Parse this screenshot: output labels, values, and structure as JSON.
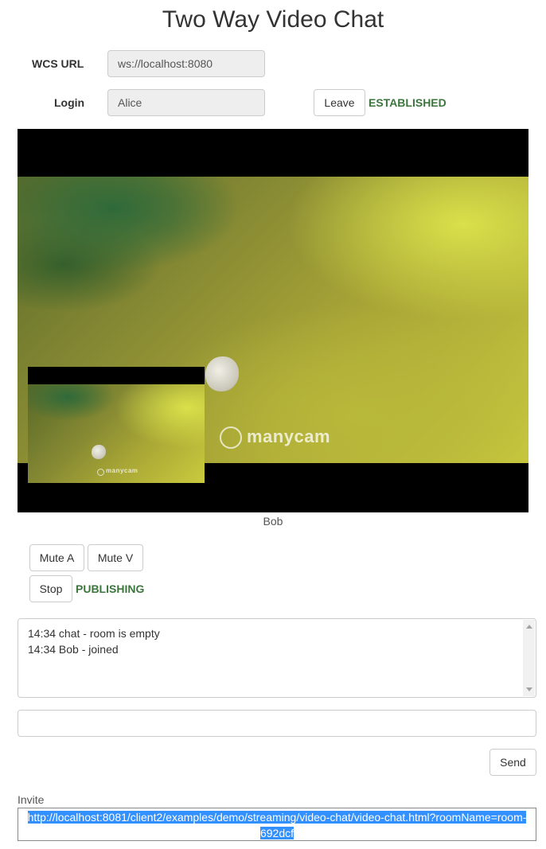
{
  "page": {
    "title": "Two Way Video Chat"
  },
  "connection": {
    "wcs_url_label": "WCS URL",
    "wcs_url_value": "ws://localhost:8080",
    "login_label": "Login",
    "login_value": "Alice",
    "leave_label": "Leave",
    "status": "ESTABLISHED"
  },
  "video": {
    "remote_participant": "Bob",
    "watermark": "manycam"
  },
  "controls": {
    "mute_audio_label": "Mute A",
    "mute_video_label": "Mute V",
    "stop_label": "Stop",
    "publish_status": "PUBLISHING"
  },
  "chat": {
    "messages": [
      "14:34 chat - room is empty",
      "14:34 Bob - joined"
    ],
    "input_value": "",
    "send_label": "Send"
  },
  "invite": {
    "label": "Invite",
    "url_line1": "http://localhost:8081/client2/examples/demo/streaming/video-chat/video-chat.html?roomName=room-",
    "url_line2": "692dcf"
  },
  "colors": {
    "status_green": "#3c763d",
    "selection_blue": "#3390ff"
  }
}
